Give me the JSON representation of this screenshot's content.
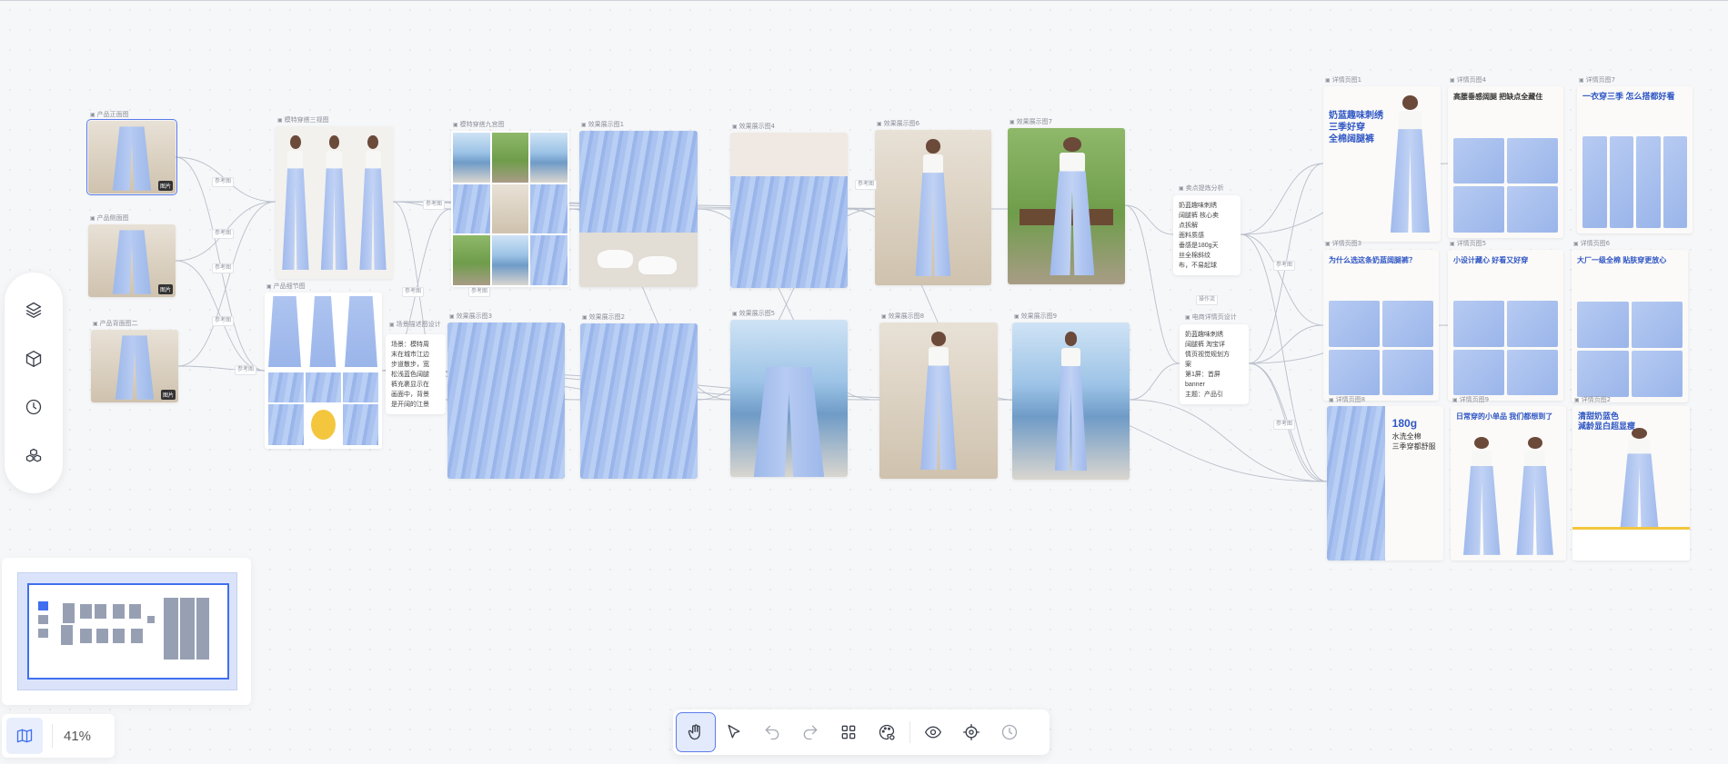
{
  "canvas": {
    "nodes": {
      "product_front": "产品正面图",
      "product_side": "产品侧面图",
      "product_back": "产品背面图二",
      "model_triple": "模特穿搭三视图",
      "model_nine": "模特穿搭九宫图",
      "product_detail": "产品细节图",
      "style_desc_label": "场景描述图设计",
      "effect_1": "效果展示图1",
      "effect_2": "效果展示图2",
      "effect_3": "效果展示图3",
      "effect_4": "效果展示图4",
      "effect_5": "效果展示图5",
      "effect_6": "效果展示图6",
      "effect_7": "效果展示图7",
      "effect_8": "效果展示图8",
      "effect_9": "效果展示图9",
      "selling_analysis": "卖点提炼分析",
      "ecommerce_page": "电商详情页设计",
      "detail_1": "详情页图1",
      "detail_4": "详情页图4",
      "detail_7": "详情页图7",
      "detail_3": "详情页图3",
      "detail_5": "详情页图5",
      "detail_6": "详情页图6",
      "detail_8": "详情页图8",
      "detail_9": "详情页图9",
      "detail_2": "详情页图2"
    },
    "badges": {
      "front": "图片",
      "side": "图片",
      "back": "图片"
    },
    "notes": {
      "scene_desc": "场景：模特周\n末在城市江边\n步道散步，宽\n松浅蓝色阔腿\n裤充裹显示在\n画面中，背景\n是开阔的江景",
      "selling_points": "奶蓝趣味刺绣\n阔腿裤 核心卖\n点拆解\n面料质感\n垂感是180g天\n丝全棉斜纹\n布，不易起球",
      "ecommerce_text": "奶蓝趣味刺绣\n阔腿裤 淘宝详\n情页视觉规划方\n案\n第1屏：首屏\nbanner\n主题：产品引"
    },
    "edge_label": "参考图",
    "edge_label_alt": "操作流",
    "posters": {
      "p1": "奶蓝趣味刺绣\n三季好穿\n全棉阔腿裤",
      "p4": "高腰垂感阔腿 把缺点全藏住",
      "p7": "一衣穿三季 怎么搭都好看",
      "p3": "为什么选这条奶蓝阔腿裤？",
      "p5": "小设计藏心 好看又好穿",
      "p6": "大厂一级全棉 贴肤穿更放心",
      "p8_num": "180g",
      "p8": "水洗全棉\n三季穿都舒服",
      "p9": "日常穿的小单品 我们都想到了",
      "p2": "清甜奶蓝色\n減龄显白超显瘦"
    }
  },
  "left_toolbar": {
    "icons": [
      "layers-icon",
      "cube-icon",
      "clock-icon",
      "cubes-icon"
    ]
  },
  "zoom": {
    "level": "41%"
  },
  "bottom_toolbar": {
    "tools": [
      "hand-tool",
      "pointer-tool",
      "undo",
      "redo",
      "grid",
      "palette",
      "eye",
      "target",
      "history"
    ]
  },
  "colors": {
    "accent": "#3f6ff0",
    "denim": "#a9c2ef",
    "background": "#f6f7f9"
  }
}
